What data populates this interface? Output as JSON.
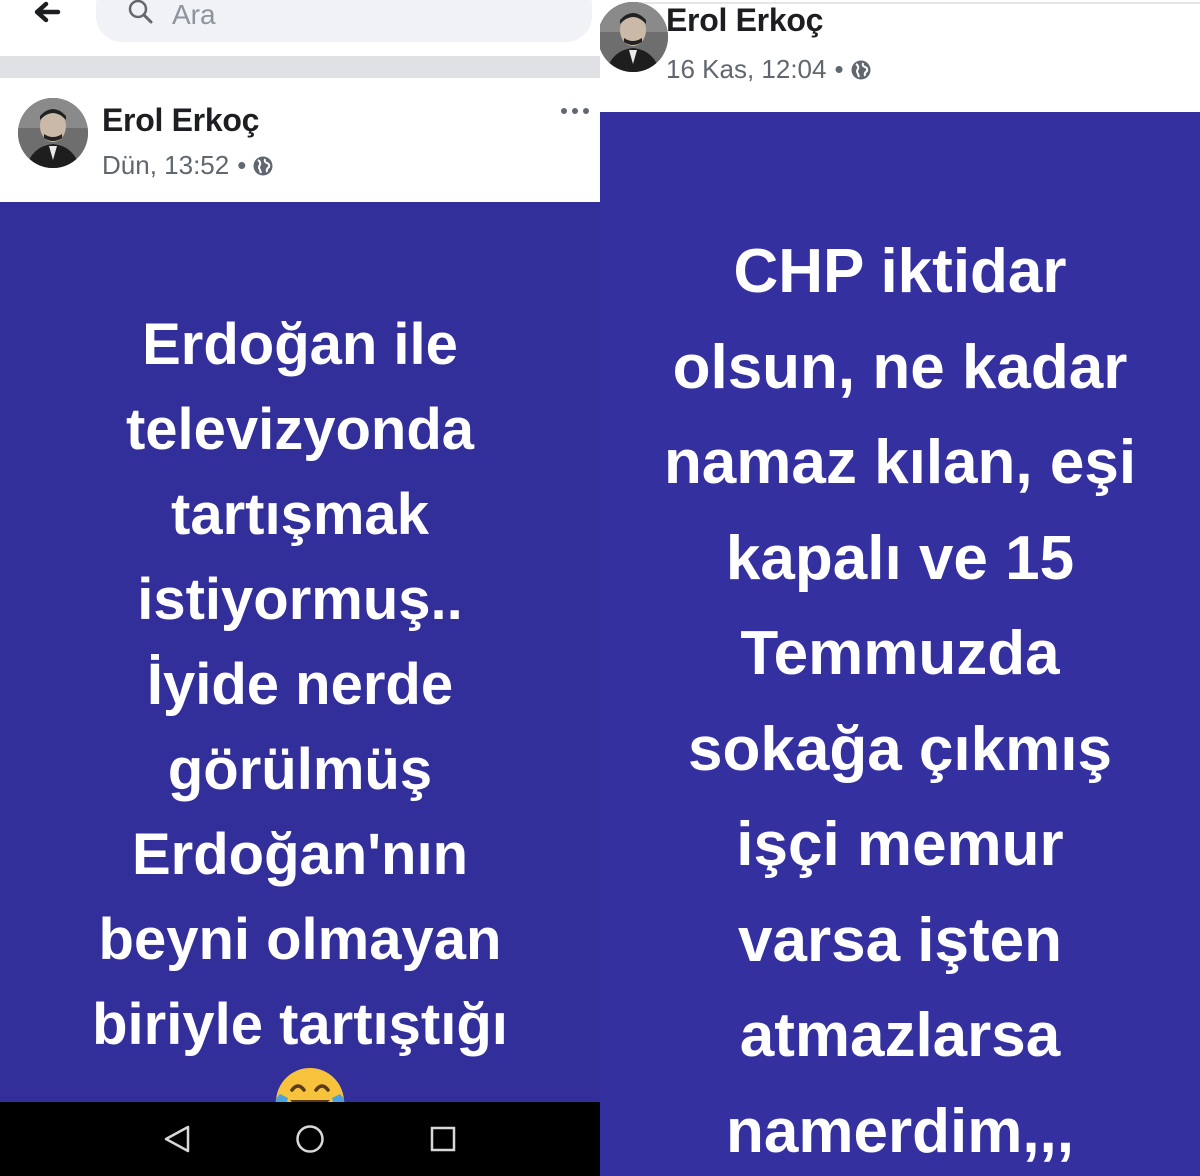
{
  "search": {
    "placeholder": "Ara"
  },
  "left_post": {
    "author": "Erol Erkoç",
    "timestamp": "Dün, 13:52",
    "separator": "•",
    "privacy_icon": "globe-icon",
    "background_color": "#322e9a",
    "text_lines": [
      "Erdoğan ile",
      "televizyonda",
      "tartışmak",
      "istiyormuş..",
      "İyide nerde",
      "görülmüş",
      "Erdoğan'nın",
      "beyni olmayan",
      "biriyle tartıştığı"
    ],
    "emoji": "face-with-tears-of-joy-icon"
  },
  "right_post": {
    "author": "Erol Erkoç",
    "timestamp": "16 Kas, 12:04",
    "separator": "•",
    "privacy_icon": "globe-icon",
    "background_color": "#3430a0",
    "text_lines": [
      "CHP iktidar",
      "olsun, ne kadar",
      "namaz kılan, eşi",
      "kapalı ve 15",
      "Temmuzda",
      "sokağa çıkmış",
      "işçi memur",
      "varsa işten",
      "atmazlarsa",
      "namerdim,,,"
    ]
  },
  "navigation": {
    "back_icon": "back-arrow-icon",
    "nav_buttons": [
      "triangle-back-icon",
      "circle-home-icon",
      "square-recents-icon"
    ],
    "nav_bar_color": "#000000"
  }
}
